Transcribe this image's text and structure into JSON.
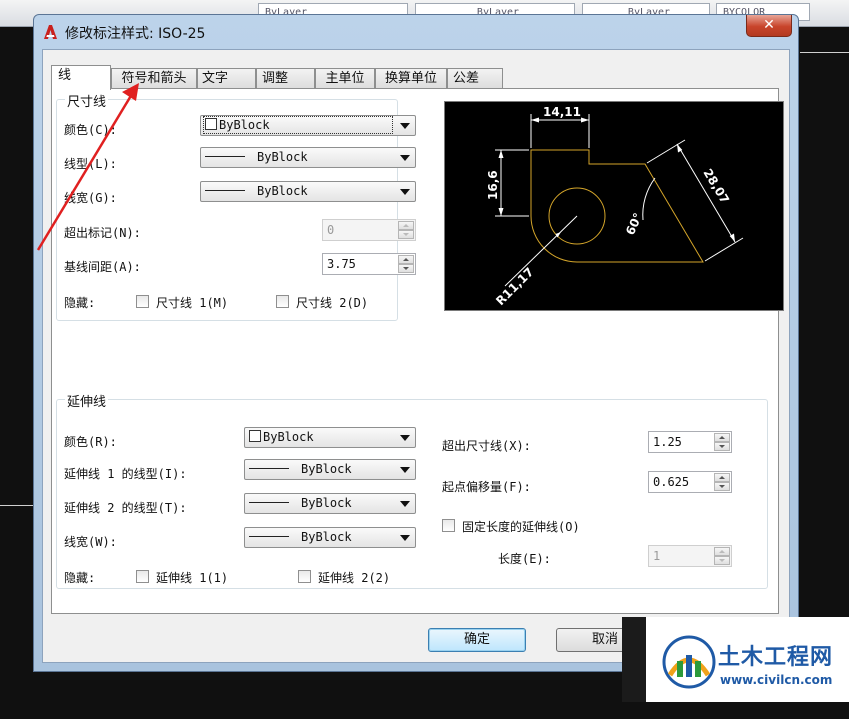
{
  "background_toolbar": {
    "combos": [
      "ByLayer",
      "ByLayer",
      "ByLayer",
      "BYCOLOR"
    ]
  },
  "dialog": {
    "title": "修改标注样式: ISO-25",
    "close_glyph": "✕",
    "tabs": [
      {
        "label": "线"
      },
      {
        "label": "符号和箭头"
      },
      {
        "label": "文字"
      },
      {
        "label": "调整"
      },
      {
        "label": "主单位"
      },
      {
        "label": "换算单位"
      },
      {
        "label": "公差"
      }
    ],
    "dim_lines": {
      "title": "尺寸线",
      "color_label": "颜色(C):",
      "color_value": "ByBlock",
      "linetype_label": "线型(L):",
      "linetype_value": "ByBlock",
      "lineweight_label": "线宽(G):",
      "lineweight_value": "ByBlock",
      "extend_ticks_label": "超出标记(N):",
      "extend_ticks_value": "0",
      "baseline_spacing_label": "基线间距(A):",
      "baseline_spacing_value": "3.75",
      "suppress_label": "隐藏:",
      "suppress_1": "尺寸线 1(M)",
      "suppress_2": "尺寸线 2(D)"
    },
    "preview": {
      "dim_top": "14,11",
      "dim_left": "16,6",
      "dim_diag": "28,07",
      "angle": "60°",
      "radius": "R11,17"
    },
    "ext_lines": {
      "title": "延伸线",
      "color_label": "颜色(R):",
      "color_value": "ByBlock",
      "linetype1_label": "延伸线 1 的线型(I):",
      "linetype1_value": "ByBlock",
      "linetype2_label": "延伸线 2 的线型(T):",
      "linetype2_value": "ByBlock",
      "lineweight_label": "线宽(W):",
      "lineweight_value": "ByBlock",
      "suppress_label": "隐藏:",
      "suppress_1": "延伸线 1(1)",
      "suppress_2": "延伸线 2(2)",
      "extend_beyond_label": "超出尺寸线(X):",
      "extend_beyond_value": "1.25",
      "offset_label": "起点偏移量(F):",
      "offset_value": "0.625",
      "fixed_length_label": "固定长度的延伸线(O)",
      "length_label": "长度(E):",
      "length_value": "1"
    },
    "buttons": {
      "ok": "确定",
      "cancel": "取消"
    }
  },
  "watermark": {
    "title": "土木工程网",
    "url": "www.civilcn.com"
  },
  "colors": {
    "annotation_arrow": "#e02020",
    "preview_geometry": "#d4a52a",
    "preview_dims": "#ffffff"
  }
}
